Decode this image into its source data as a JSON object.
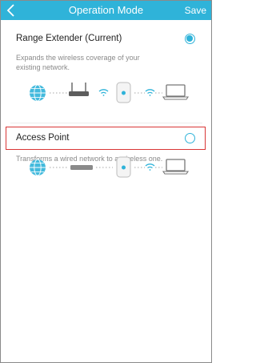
{
  "header": {
    "title": "Operation Mode",
    "save_label": "Save",
    "back_icon": "chevron-left-icon"
  },
  "options": [
    {
      "label": "Range Extender (Current)",
      "description_line1": "Expands the wireless coverage of your",
      "description_line2": "existing network.",
      "selected": true,
      "diagram": [
        "globe-icon",
        "router-icon",
        "wifi-icon",
        "range-extender-icon",
        "wifi-icon",
        "laptop-icon"
      ]
    },
    {
      "label": "Access Point",
      "description_line1": "Transforms a wired network to a wireless one.",
      "selected": false,
      "diagram": [
        "globe-icon",
        "modem-icon",
        "range-extender-icon",
        "wifi-icon",
        "laptop-icon"
      ]
    }
  ],
  "colors": {
    "accent": "#2fb3d9",
    "highlight_border": "#d93636"
  }
}
